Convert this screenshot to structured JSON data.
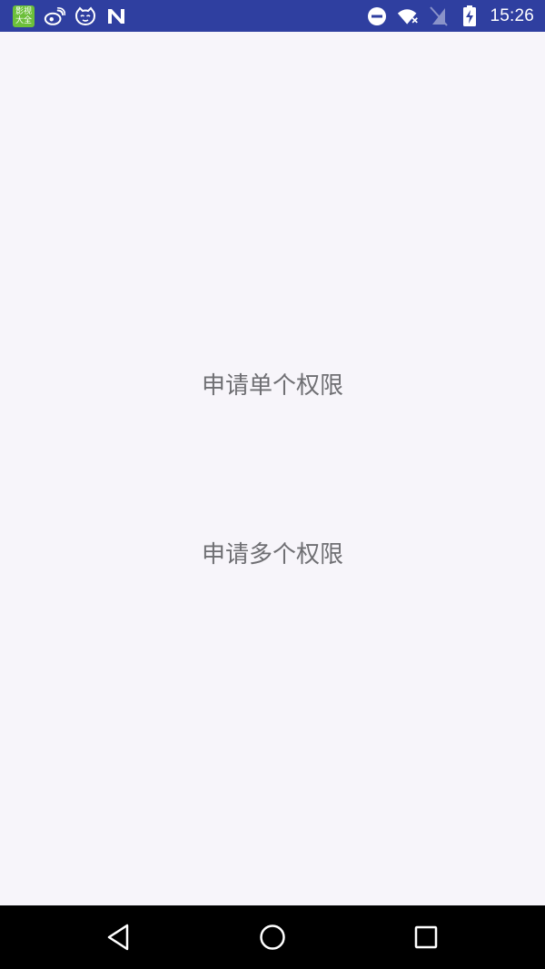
{
  "status_bar": {
    "time": "15:26",
    "app_badge_line1": "影视",
    "app_badge_line2": "大全",
    "colors": {
      "background": "#2f3fa0",
      "foreground": "#ffffff"
    },
    "icons_left": [
      "video-app-icon",
      "weibo-icon",
      "cat-face-icon",
      "n-logo-icon"
    ],
    "icons_right": [
      "do-not-disturb-icon",
      "wifi-icon",
      "no-sim-icon",
      "battery-charging-icon"
    ]
  },
  "main": {
    "background": "#f7f5fa",
    "buttons": {
      "single": "申请单个权限",
      "multiple": "申请多个权限"
    }
  },
  "nav_bar": {
    "icons": [
      "back-icon",
      "home-icon",
      "recents-icon"
    ]
  }
}
